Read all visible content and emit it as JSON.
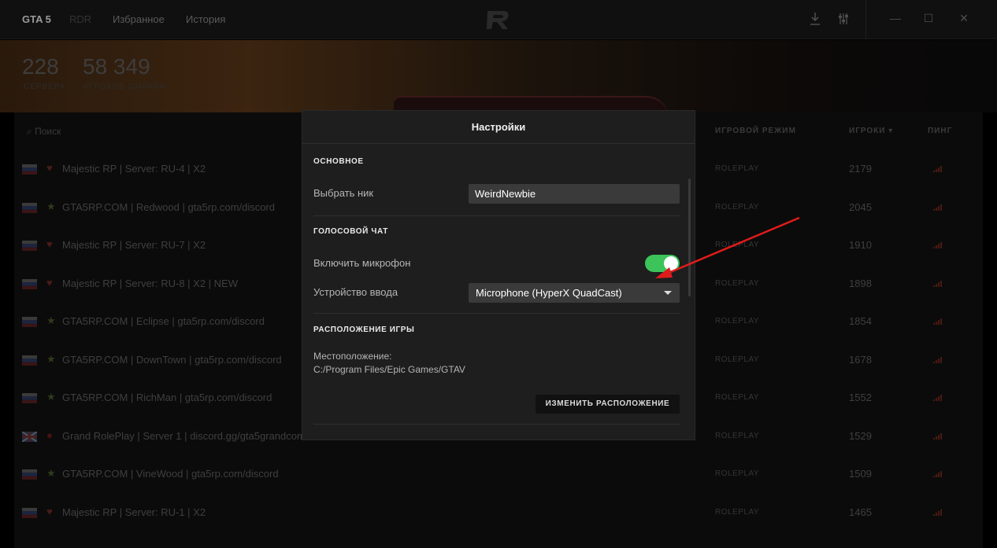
{
  "nav": {
    "tabs": [
      {
        "label": "GTA 5",
        "active": true
      },
      {
        "label": "RDR",
        "active": false
      },
      {
        "label": "Избранное",
        "active": false
      },
      {
        "label": "История",
        "active": false
      }
    ]
  },
  "stats": {
    "servers_count": "228",
    "servers_label": "СЕРВЕРА",
    "players_count": "58 349",
    "players_label": "ИГРОКОВ ОНЛАЙН"
  },
  "table": {
    "search_placeholder": "Поиск",
    "headers": {
      "mode": "ИГРОВОЙ РЕЖИМ",
      "players": "ИГРОКИ",
      "ping": "ПИНГ"
    },
    "rows": [
      {
        "flag": "ru",
        "fav": "heart",
        "name": "Majestic RP | Server: RU-4 | X2",
        "mode": "ROLEPLAY",
        "players": "2179"
      },
      {
        "flag": "ru",
        "fav": "star",
        "name": "GTA5RP.COM | Redwood | gta5rp.com/discord",
        "mode": "ROLEPLAY",
        "players": "2045"
      },
      {
        "flag": "ru",
        "fav": "heart",
        "name": "Majestic RP | Server: RU-7 | X2",
        "mode": "ROLEPLAY",
        "players": "1910"
      },
      {
        "flag": "ru",
        "fav": "heart",
        "name": "Majestic RP | Server: RU-8 | X2 | NEW",
        "mode": "ROLEPLAY",
        "players": "1898"
      },
      {
        "flag": "ru",
        "fav": "star",
        "name": "GTA5RP.COM | Eclipse | gta5rp.com/discord",
        "mode": "ROLEPLAY",
        "players": "1854"
      },
      {
        "flag": "ru",
        "fav": "star",
        "name": "GTA5RP.COM | DownTown | gta5rp.com/discord",
        "mode": "ROLEPLAY",
        "players": "1678"
      },
      {
        "flag": "ru",
        "fav": "star",
        "name": "GTA5RP.COM | RichMan | gta5rp.com/discord",
        "mode": "ROLEPLAY",
        "players": "1552"
      },
      {
        "flag": "uk",
        "fav": "circle",
        "name": "Grand RolePlay | Server 1 | discord.gg/gta5grandcom",
        "mode": "ROLEPLAY",
        "players": "1529"
      },
      {
        "flag": "ru",
        "fav": "star",
        "name": "GTA5RP.COM | VineWood | gta5rp.com/discord",
        "mode": "ROLEPLAY",
        "players": "1509"
      },
      {
        "flag": "ru",
        "fav": "heart",
        "name": "Majestic RP | Server: RU-1 | X2",
        "mode": "ROLEPLAY",
        "players": "1465"
      }
    ]
  },
  "settings": {
    "title": "Настройки",
    "general": {
      "section": "ОСНОВНОЕ",
      "nick_label": "Выбрать ник",
      "nick_value": "WeirdNewbie"
    },
    "voice": {
      "section": "ГОЛОСОВОЙ ЧАТ",
      "mic_label": "Включить микрофон",
      "mic_enabled": true,
      "device_label": "Устройство ввода",
      "device_value": "Microphone (HyperX QuadCast)"
    },
    "location": {
      "section": "РАСПОЛОЖЕНИЕ ИГРЫ",
      "path_label": "Местоположение:",
      "path_value": "C:/Program Files/Epic Games/GTAV",
      "change_button": "ИЗМЕНИТЬ РАСПОЛОЖЕНИЕ"
    }
  },
  "colors": {
    "toggle_on": "#3cc45a",
    "annotation_arrow": "#e01b1b",
    "modal_bg": "#1e1e1e"
  }
}
